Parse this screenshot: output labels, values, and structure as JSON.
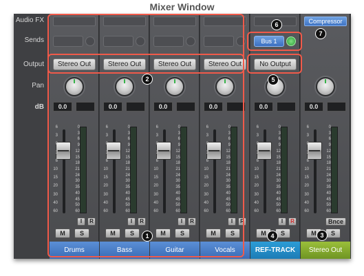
{
  "page_title": "Mixer Window",
  "row_labels": {
    "audio_fx": "Audio FX",
    "sends": "Sends",
    "output": "Output",
    "pan": "Pan",
    "db": "dB"
  },
  "strips": [
    {
      "name": "Drums",
      "output": "Stereo Out",
      "db": "0.0",
      "m": "M",
      "s": "S",
      "i": "I",
      "r": "R"
    },
    {
      "name": "Bass",
      "output": "Stereo Out",
      "db": "0.0",
      "m": "M",
      "s": "S",
      "i": "I",
      "r": "R"
    },
    {
      "name": "Guitar",
      "output": "Stereo Out",
      "db": "0.0",
      "m": "M",
      "s": "S",
      "i": "I",
      "r": "R"
    },
    {
      "name": "Vocals",
      "output": "Stereo Out",
      "db": "0.0",
      "m": "M",
      "s": "S",
      "i": "I",
      "r": "R"
    },
    {
      "name": "REF-TRACK",
      "output": "No Output",
      "send": "Bus 1",
      "db": "0.0",
      "m": "M",
      "s": "S",
      "i": "I",
      "r": "R"
    },
    {
      "name": "Stereo Out",
      "audio_fx": "Compressor",
      "db": "0.0",
      "m": "M",
      "s": "S",
      "bounce": "Bnce"
    }
  ],
  "fader_scale_left": [
    "6",
    "3",
    "0",
    "3",
    "6",
    "10",
    "15",
    "20",
    "30",
    "40",
    "60"
  ],
  "meter_scale": [
    "0",
    "3",
    "6",
    "9",
    "12",
    "15",
    "18",
    "21",
    "24",
    "30",
    "35",
    "40",
    "45",
    "50",
    "60"
  ],
  "callouts": [
    "1",
    "2",
    "3",
    "4",
    "5",
    "6",
    "7"
  ],
  "colors": {
    "callout": "#f15a4a",
    "track_blue": "#3a6cb6",
    "ref_blue": "#1c7cb6",
    "master_green": "#6f9523",
    "active_send": "#2c9a3a"
  }
}
